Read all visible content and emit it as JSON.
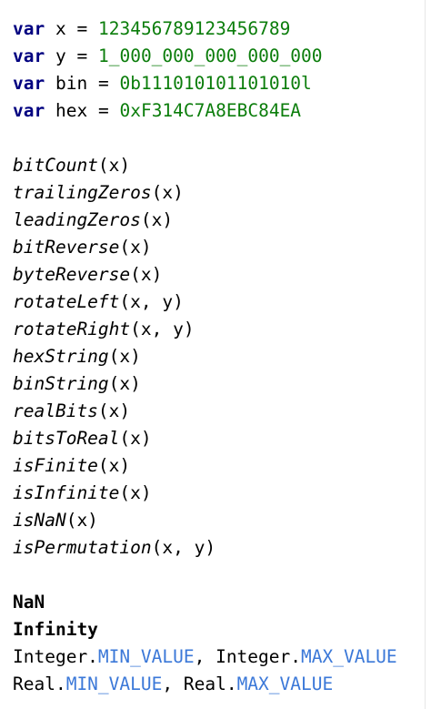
{
  "colors": {
    "keyword": "#000080",
    "number": "#0b7d0b",
    "field": "#3b78d8",
    "text": "#000000",
    "background": "#ffffff"
  },
  "declarations": [
    {
      "keyword": "var",
      "name": "x",
      "op": "=",
      "value": "123456789123456789"
    },
    {
      "keyword": "var",
      "name": "y",
      "op": "=",
      "value": "1_000_000_000_000_000"
    },
    {
      "keyword": "var",
      "name": "bin",
      "op": "=",
      "value": "0b111010101101010l"
    },
    {
      "keyword": "var",
      "name": "hex",
      "op": "=",
      "value": "0xF314C7A8EBC84EA"
    }
  ],
  "calls": [
    {
      "fn": "bitCount",
      "args": "(x)"
    },
    {
      "fn": "trailingZeros",
      "args": "(x)"
    },
    {
      "fn": "leadingZeros",
      "args": "(x)"
    },
    {
      "fn": "bitReverse",
      "args": "(x)"
    },
    {
      "fn": "byteReverse",
      "args": "(x)"
    },
    {
      "fn": "rotateLeft",
      "args": "(x, y)"
    },
    {
      "fn": "rotateRight",
      "args": "(x, y)"
    },
    {
      "fn": "hexString",
      "args": "(x)"
    },
    {
      "fn": "binString",
      "args": "(x)"
    },
    {
      "fn": "realBits",
      "args": "(x)"
    },
    {
      "fn": "bitsToReal",
      "args": "(x)"
    },
    {
      "fn": "isFinite",
      "args": "(x)"
    },
    {
      "fn": "isInfinite",
      "args": "(x)"
    },
    {
      "fn": "isNaN",
      "args": "(x)"
    },
    {
      "fn": "isPermutation",
      "args": "(x, y)"
    }
  ],
  "constants": {
    "nan": "NaN",
    "infinity": "Infinity"
  },
  "integer_line": {
    "cls1": "Integer.",
    "field1": "MIN_VALUE",
    "sep": ", ",
    "cls2": "Integer.",
    "field2": "MAX_VALUE"
  },
  "real_line": {
    "cls1": "Real.",
    "field1": "MIN_VALUE",
    "sep": ", ",
    "cls2": "Real.",
    "field2": "MAX_VALUE"
  }
}
